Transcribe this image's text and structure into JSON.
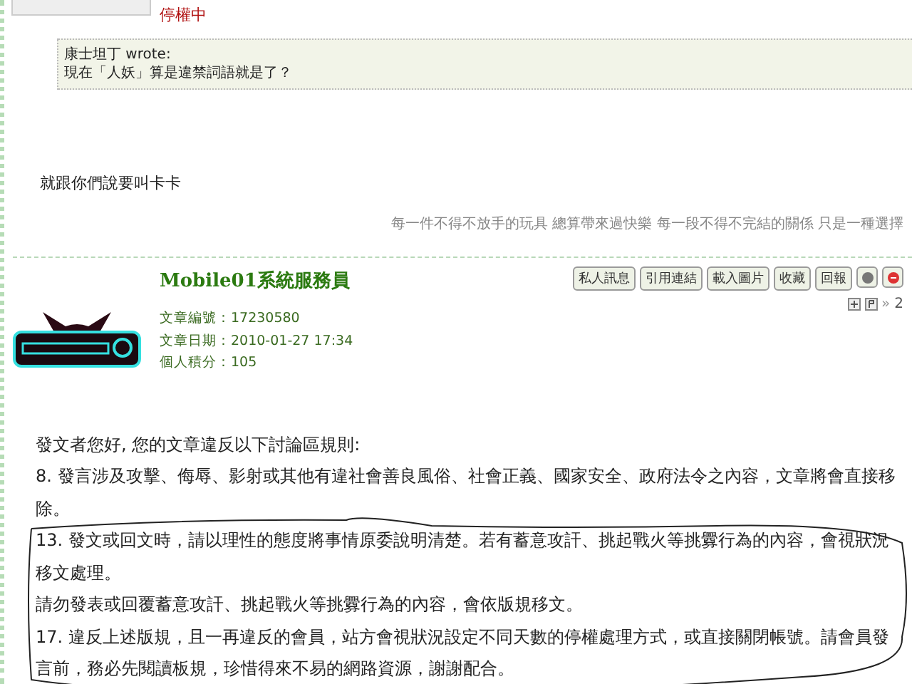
{
  "previous_post": {
    "status": "停權中",
    "quote": {
      "author_line": "康士坦丁 wrote:",
      "text": "現在「人妖」算是違禁詞語就是了？"
    },
    "body": "就跟你們說要叫卡卡",
    "signature": "每一件不得不放手的玩具 總算帶來過快樂 每一段不得不完結的關係 只是一種選擇"
  },
  "post": {
    "username": "Mobile01系統服務員",
    "actions": [
      "私人訊息",
      "引用連結",
      "載入圖片",
      "收藏",
      "回報"
    ],
    "floor_prefix": "»",
    "floor": "2",
    "meta": [
      {
        "label": "文章編號：",
        "value": "17230580"
      },
      {
        "label": "文章日期：",
        "value": "2010-01-27 17:34"
      },
      {
        "label": "個人積分：",
        "value": "105"
      }
    ],
    "paragraphs": [
      "發文者您好, 您的文章違反以下討論區規則:",
      "8. 發言涉及攻擊、侮辱、影射或其他有違社會善良風俗、社會正義、國家安全、政府法令之內容，文章將會直接移除。",
      "13. 發文或回文時，請以理性的態度將事情原委說明清楚。若有蓄意攻訐、挑起戰火等挑釁行為的內容，會視狀況移文處理。",
      "請勿發表或回覆蓄意攻訐、挑起戰火等挑釁行為的內容，會依版規移文。",
      "17. 違反上述版規，且一再違反的會員，站方會視狀況設定不同天數的停權處理方式，或直接關閉帳號。請會員發言前，務必先閱讀板規，珍惜得來不易的網路資源，謝謝配合。"
    ]
  }
}
